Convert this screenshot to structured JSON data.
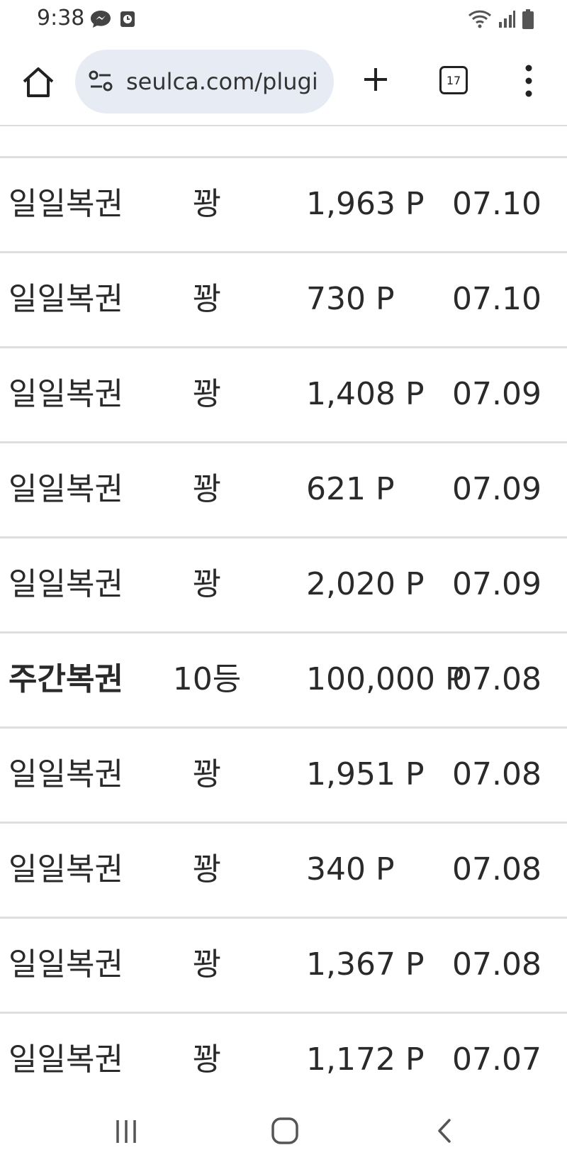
{
  "status_bar": {
    "time": "9:38",
    "left_icons": [
      "messenger-icon",
      "alarm-icon"
    ],
    "right_icons": [
      "wifi-icon",
      "signal-icon",
      "battery-icon"
    ]
  },
  "browser": {
    "url": "seulca.com/plugi",
    "tab_count": "17",
    "icons": [
      "home-icon",
      "site-info-icon",
      "plus-icon",
      "tabs-icon",
      "more-vert-icon"
    ]
  },
  "table": {
    "rows": [
      {
        "name": "일일복권",
        "rank": "꽝",
        "points": "1,963 P",
        "date": "07.10"
      },
      {
        "name": "일일복권",
        "rank": "꽝",
        "points": "730 P",
        "date": "07.10"
      },
      {
        "name": "일일복권",
        "rank": "꽝",
        "points": "1,408 P",
        "date": "07.09"
      },
      {
        "name": "일일복권",
        "rank": "꽝",
        "points": "621 P",
        "date": "07.09"
      },
      {
        "name": "일일복권",
        "rank": "꽝",
        "points": "2,020 P",
        "date": "07.09"
      },
      {
        "name": "주간복권",
        "rank": "10등",
        "points": "100,000 P",
        "date": "07.08",
        "bold": true
      },
      {
        "name": "일일복권",
        "rank": "꽝",
        "points": "1,951 P",
        "date": "07.08"
      },
      {
        "name": "일일복권",
        "rank": "꽝",
        "points": "340 P",
        "date": "07.08"
      },
      {
        "name": "일일복권",
        "rank": "꽝",
        "points": "1,367 P",
        "date": "07.08"
      },
      {
        "name": "일일복권",
        "rank": "꽝",
        "points": "1,172 P",
        "date": "07.07"
      }
    ]
  },
  "nav_bar": {
    "icons": [
      "recents-icon",
      "home-circle-icon",
      "back-icon"
    ]
  }
}
